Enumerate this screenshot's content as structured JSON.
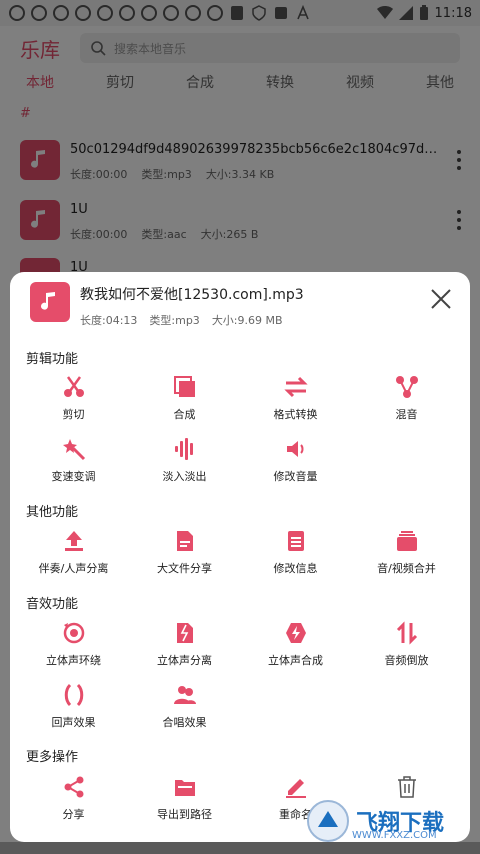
{
  "status_bar": {
    "time": "11:18"
  },
  "header": {
    "title": "乐库",
    "search_placeholder": "搜索本地音乐"
  },
  "tabs": [
    "本地",
    "剪切",
    "合成",
    "转换",
    "视频",
    "其他"
  ],
  "section_hash": "#",
  "list": [
    {
      "name": "50c01294df9d48902639978235bcb56c6e2c1804c97d4...",
      "duration": "长度:00:00",
      "type": "类型:mp3",
      "size": "大小:3.34 KB"
    },
    {
      "name": "1U",
      "duration": "长度:00:00",
      "type": "类型:aac",
      "size": "大小:265 B"
    },
    {
      "name": "1U",
      "duration": "",
      "type": "",
      "size": ""
    }
  ],
  "sheet": {
    "file_name": "教我如何不爱他[12530.com].mp3",
    "duration": "长度:04:13",
    "type": "类型:mp3",
    "size": "大小:9.69 MB",
    "sections": [
      {
        "title": "剪辑功能",
        "items": [
          {
            "label": "剪切",
            "icon": "scissors-icon"
          },
          {
            "label": "合成",
            "icon": "merge-icon"
          },
          {
            "label": "格式转换",
            "icon": "convert-arrows-icon"
          },
          {
            "label": "混音",
            "icon": "mix-icon"
          },
          {
            "label": "变速变调",
            "icon": "magic-wand-icon"
          },
          {
            "label": "淡入淡出",
            "icon": "waveform-icon"
          },
          {
            "label": "修改音量",
            "icon": "volume-icon"
          }
        ]
      },
      {
        "title": "其他功能",
        "items": [
          {
            "label": "伴奏/人声分离",
            "icon": "upload-icon"
          },
          {
            "label": "大文件分享",
            "icon": "document-icon"
          },
          {
            "label": "修改信息",
            "icon": "info-document-icon"
          },
          {
            "label": "音/视频合并",
            "icon": "stack-icon"
          }
        ]
      },
      {
        "title": "音效功能",
        "items": [
          {
            "label": "立体声环绕",
            "icon": "surround-icon"
          },
          {
            "label": "立体声分离",
            "icon": "split-icon"
          },
          {
            "label": "立体声合成",
            "icon": "bolt-icon"
          },
          {
            "label": "音频倒放",
            "icon": "reverse-icon"
          },
          {
            "label": "回声效果",
            "icon": "echo-icon"
          },
          {
            "label": "合唱效果",
            "icon": "chorus-icon"
          }
        ]
      },
      {
        "title": "更多操作",
        "items": [
          {
            "label": "分享",
            "icon": "share-icon"
          },
          {
            "label": "导出到路径",
            "icon": "export-icon"
          },
          {
            "label": "重命名",
            "icon": "rename-icon"
          },
          {
            "label": "",
            "icon": "trash-icon"
          }
        ]
      }
    ]
  },
  "watermark": {
    "text": "飞翔下载",
    "url": "WWW.FXXZ.COM"
  },
  "colors": {
    "accent": "#e54d6a"
  }
}
